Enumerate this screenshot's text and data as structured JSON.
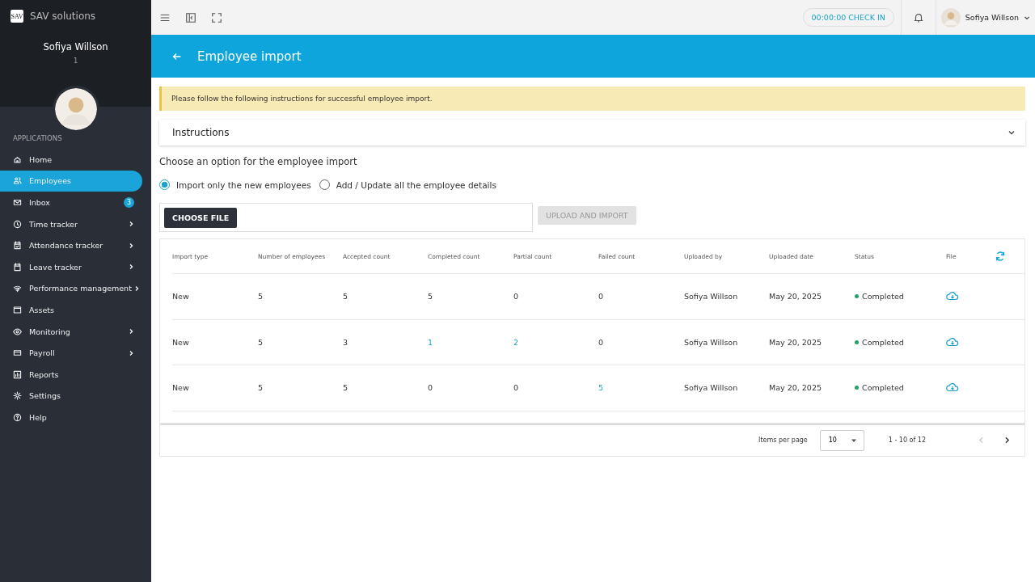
{
  "brand": {
    "logo": "SAV",
    "name": "SAV solutions"
  },
  "profile": {
    "name": "Sofiya Willson",
    "id": "1"
  },
  "sidebar": {
    "section": "APPLICATIONS",
    "items": [
      {
        "label": "Home",
        "selected": false,
        "arrow": false
      },
      {
        "label": "Employees",
        "selected": true,
        "arrow": false
      },
      {
        "label": "Inbox",
        "selected": false,
        "arrow": false,
        "badge": "3"
      },
      {
        "label": "Time tracker",
        "selected": false,
        "arrow": true
      },
      {
        "label": "Attendance tracker",
        "selected": false,
        "arrow": true
      },
      {
        "label": "Leave tracker",
        "selected": false,
        "arrow": true
      },
      {
        "label": "Performance management",
        "selected": false,
        "arrow": true
      },
      {
        "label": "Assets",
        "selected": false,
        "arrow": false
      },
      {
        "label": "Monitoring",
        "selected": false,
        "arrow": true
      },
      {
        "label": "Payroll",
        "selected": false,
        "arrow": true
      },
      {
        "label": "Reports",
        "selected": false,
        "arrow": false
      },
      {
        "label": "Settings",
        "selected": false,
        "arrow": false
      },
      {
        "label": "Help",
        "selected": false,
        "arrow": false
      }
    ]
  },
  "topbar": {
    "check_in": "00:00:00 CHECK IN",
    "user": "Sofiya Willson"
  },
  "page": {
    "title": "Employee import"
  },
  "notice": "Please follow the following instructions for successful employee import.",
  "instructions": {
    "title": "Instructions",
    "expanded": false
  },
  "option_prompt": "Choose an option for the employee import",
  "options": [
    {
      "label": "Import only the new employees",
      "selected": true
    },
    {
      "label": "Add / Update all the employee details",
      "selected": false
    }
  ],
  "choose_file": "CHOOSE FILE",
  "upload": {
    "label": "UPLOAD AND IMPORT",
    "disabled": true
  },
  "table": {
    "columns": [
      "Import type",
      "Number of employees",
      "Accepted count",
      "Completed count",
      "Partial count",
      "Failed count",
      "Uploaded by",
      "Uploaded date",
      "Status",
      "File"
    ],
    "rows": [
      {
        "cells": [
          {
            "text": "New",
            "link": false
          },
          {
            "text": "5",
            "link": false
          },
          {
            "text": "5",
            "link": false
          },
          {
            "text": "5",
            "link": false
          },
          {
            "text": "0",
            "link": false
          },
          {
            "text": "0",
            "link": false
          },
          {
            "text": "Sofiya Willson",
            "link": false
          },
          {
            "text": "May 20, 2025",
            "link": false
          }
        ],
        "status": "Completed"
      },
      {
        "cells": [
          {
            "text": "New",
            "link": false
          },
          {
            "text": "5",
            "link": false
          },
          {
            "text": "3",
            "link": false
          },
          {
            "text": "1",
            "link": true
          },
          {
            "text": "2",
            "link": true
          },
          {
            "text": "0",
            "link": false
          },
          {
            "text": "Sofiya Willson",
            "link": false
          },
          {
            "text": "May 20, 2025",
            "link": false
          }
        ],
        "status": "Completed"
      },
      {
        "cells": [
          {
            "text": "New",
            "link": false
          },
          {
            "text": "5",
            "link": false
          },
          {
            "text": "5",
            "link": false
          },
          {
            "text": "0",
            "link": false
          },
          {
            "text": "0",
            "link": false
          },
          {
            "text": "5",
            "link": true
          },
          {
            "text": "Sofiya Willson",
            "link": false
          },
          {
            "text": "May 20, 2025",
            "link": false
          }
        ],
        "status": "Completed"
      }
    ]
  },
  "paginator": {
    "label": "Items per page",
    "page_size": "10",
    "range": "1 - 10 of 12",
    "prev_disabled": true,
    "next_disabled": false
  }
}
